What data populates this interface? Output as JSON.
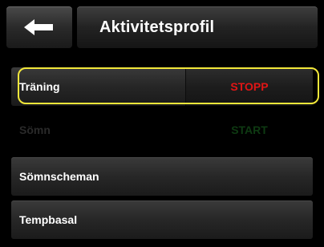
{
  "header": {
    "title": "Aktivitetsprofil",
    "back_icon": "arrow-left-icon"
  },
  "rows": [
    {
      "label": "Träning",
      "action": "STOPP",
      "action_color": "#e01515",
      "selected": true
    },
    {
      "label": "Sömn",
      "action": "START",
      "action_color": "#0e3a12",
      "enabled": false
    },
    {
      "label": "Sömnscheman"
    },
    {
      "label": "Tempbasal"
    }
  ],
  "colors": {
    "background": "#000000",
    "highlight": "#f2e73a",
    "text": "#ffffff"
  }
}
